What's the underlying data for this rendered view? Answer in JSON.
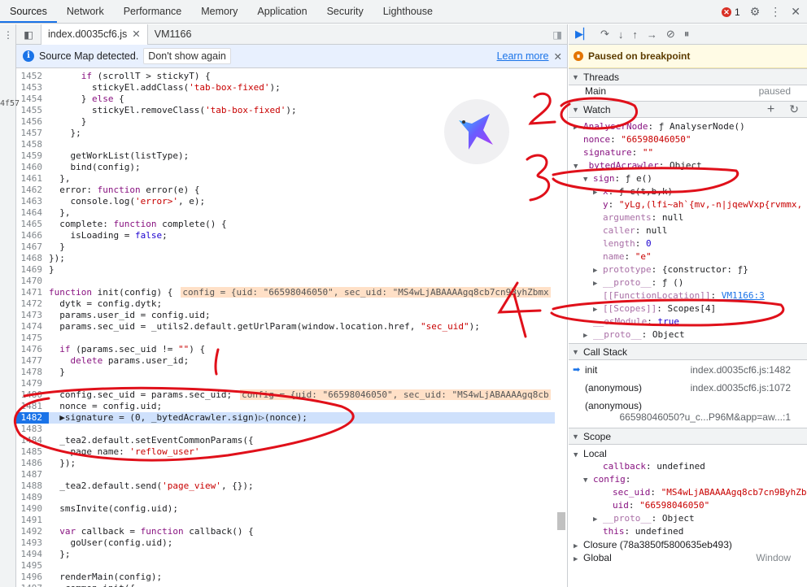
{
  "devtools_tabs": [
    "Sources",
    "Network",
    "Performance",
    "Memory",
    "Application",
    "Security",
    "Lighthouse"
  ],
  "active_tab": "Sources",
  "error_count": "1",
  "left_strip_label": "4f57",
  "file_tabs": [
    "index.d0035cf6.js",
    "VM1166"
  ],
  "source_map": {
    "message": "Source Map detected.",
    "dont_show": "Don't show again",
    "learn_more": "Learn more"
  },
  "paused_banner": "Paused on breakpoint",
  "code_lines": [
    {
      "n": "1452",
      "t": "      if (scrollT > stickyT) {"
    },
    {
      "n": "1453",
      "t": "        stickyEl.addClass('tab-box-fixed');"
    },
    {
      "n": "1454",
      "t": "      } else {"
    },
    {
      "n": "1455",
      "t": "        stickyEl.removeClass('tab-box-fixed');"
    },
    {
      "n": "1456",
      "t": "      }"
    },
    {
      "n": "1457",
      "t": "    };"
    },
    {
      "n": "1458",
      "t": ""
    },
    {
      "n": "1459",
      "t": "    getWorkList(listType);"
    },
    {
      "n": "1460",
      "t": "    bind(config);"
    },
    {
      "n": "1461",
      "t": "  },"
    },
    {
      "n": "1462",
      "t": "  error: function error(e) {"
    },
    {
      "n": "1463",
      "t": "    console.log('error>', e);"
    },
    {
      "n": "1464",
      "t": "  },"
    },
    {
      "n": "1465",
      "t": "  complete: function complete() {"
    },
    {
      "n": "1466",
      "t": "    isLoading = false;"
    },
    {
      "n": "1467",
      "t": "  }"
    },
    {
      "n": "1468",
      "t": "});"
    },
    {
      "n": "1469",
      "t": "}"
    },
    {
      "n": "1470",
      "t": ""
    },
    {
      "n": "1471",
      "t": "function init(config) {",
      "v": "config = {uid: \"66598046050\", sec_uid: \"MS4wLjABAAAAgq8cb7cn9ByhZbmx"
    },
    {
      "n": "1472",
      "t": "  dytk = config.dytk;"
    },
    {
      "n": "1473",
      "t": "  params.user_id = config.uid;"
    },
    {
      "n": "1474",
      "t": "  params.sec_uid = _utils2.default.getUrlParam(window.location.href, \"sec_uid\");"
    },
    {
      "n": "1475",
      "t": ""
    },
    {
      "n": "1476",
      "t": "  if (params.sec_uid != \"\") {"
    },
    {
      "n": "1477",
      "t": "    delete params.user_id;"
    },
    {
      "n": "1478",
      "t": "  }"
    },
    {
      "n": "1479",
      "t": ""
    },
    {
      "n": "1480",
      "t": "  config.sec_uid = params.sec_uid;",
      "v": "config = {uid: \"66598046050\", sec_uid: \"MS4wLjABAAAAgq8cb"
    },
    {
      "n": "1481",
      "t": "  nonce = config.uid;"
    },
    {
      "n": "1482",
      "t": "  ▶signature = (0, _bytedAcrawler.sign)▷(nonce);",
      "hl": true
    },
    {
      "n": "1483",
      "t": ""
    },
    {
      "n": "1484",
      "t": "  _tea2.default.setEventCommonParams({"
    },
    {
      "n": "1485",
      "t": "    page_name: 'reflow_user'"
    },
    {
      "n": "1486",
      "t": "  });"
    },
    {
      "n": "1487",
      "t": ""
    },
    {
      "n": "1488",
      "t": "  _tea2.default.send('page_view', {});"
    },
    {
      "n": "1489",
      "t": ""
    },
    {
      "n": "1490",
      "t": "  smsInvite(config.uid);"
    },
    {
      "n": "1491",
      "t": ""
    },
    {
      "n": "1492",
      "t": "  var callback = function callback() {"
    },
    {
      "n": "1493",
      "t": "    goUser(config.uid);"
    },
    {
      "n": "1494",
      "t": "  };"
    },
    {
      "n": "1495",
      "t": ""
    },
    {
      "n": "1496",
      "t": "  renderMain(config);"
    },
    {
      "n": "1497",
      "t": "  _common.init({"
    }
  ],
  "threads": {
    "title": "Threads",
    "main": "Main",
    "status": "paused"
  },
  "watch": {
    "title": "Watch",
    "rows": [
      {
        "i": 0,
        "tri": "▶",
        "k": "AnalyserNode",
        "v": "ƒ AnalyserNode()"
      },
      {
        "i": 0,
        "tri": "",
        "k": "nonce",
        "v": "\"66598046050\"",
        "c": "pstr"
      },
      {
        "i": 0,
        "tri": "",
        "k": "signature",
        "v": "\"\"",
        "c": "pstr"
      },
      {
        "i": 0,
        "tri": "▼",
        "k": "_bytedAcrawler",
        "v": "Object"
      },
      {
        "i": 1,
        "tri": "▼",
        "k": "sign",
        "v": "ƒ e()"
      },
      {
        "i": 2,
        "tri": "▶",
        "k": "x",
        "v": "ƒ c(t,b,k)"
      },
      {
        "i": 2,
        "tri": "",
        "k": "y",
        "v": "\"yLg,(lfi~ah`{mv,-n|jqewVxp{rvmmx,",
        "c": "pstr"
      },
      {
        "i": 2,
        "tri": "",
        "k": "arguments",
        "v": "null",
        "d": true
      },
      {
        "i": 2,
        "tri": "",
        "k": "caller",
        "v": "null",
        "d": true
      },
      {
        "i": 2,
        "tri": "",
        "k": "length",
        "v": "0",
        "c": "pnum",
        "d": true
      },
      {
        "i": 2,
        "tri": "",
        "k": "name",
        "v": "\"e\"",
        "c": "pstr",
        "d": true
      },
      {
        "i": 2,
        "tri": "▶",
        "k": "prototype",
        "v": "{constructor: ƒ}",
        "d": true
      },
      {
        "i": 2,
        "tri": "▶",
        "k": "__proto__",
        "v": "ƒ ()",
        "d": true
      },
      {
        "i": 2,
        "tri": "",
        "k": "[[FunctionLocation]]",
        "v": "VM1166:3",
        "c": "plink",
        "d": true
      },
      {
        "i": 2,
        "tri": "▶",
        "k": "[[Scopes]]",
        "v": "Scopes[4]",
        "d": true
      },
      {
        "i": 1,
        "tri": "",
        "k": "__esModule",
        "v": "true",
        "c": "pnum",
        "d": true
      },
      {
        "i": 1,
        "tri": "▶",
        "k": "__proto__",
        "v": "Object",
        "d": true
      }
    ]
  },
  "call_stack": {
    "title": "Call Stack",
    "frames": [
      {
        "fn": "init",
        "loc": "index.d0035cf6.js:1482",
        "cur": true
      },
      {
        "fn": "(anonymous)",
        "loc": "index.d0035cf6.js:1072"
      },
      {
        "fn": "(anonymous)",
        "loc": "66598046050?u_c...P96M&app=aw...:1"
      }
    ]
  },
  "scope": {
    "title": "Scope",
    "rows": [
      {
        "i": 0,
        "tri": "▼",
        "k": "Local",
        "v": "",
        "plain": true
      },
      {
        "i": 2,
        "tri": "",
        "k": "callback",
        "v": "undefined"
      },
      {
        "i": 1,
        "tri": "▼",
        "k": "config",
        "v": ""
      },
      {
        "i": 3,
        "tri": "",
        "k": "sec_uid",
        "v": "\"MS4wLjABAAAAgq8cb7cn9ByhZbm",
        "c": "pstr"
      },
      {
        "i": 3,
        "tri": "",
        "k": "uid",
        "v": "\"66598046050\"",
        "c": "pstr"
      },
      {
        "i": 2,
        "tri": "▶",
        "k": "__proto__",
        "v": "Object",
        "d": true
      },
      {
        "i": 2,
        "tri": "",
        "k": "this",
        "v": "undefined"
      },
      {
        "i": 0,
        "tri": "▶",
        "k": "Closure (78a3850f5800635eb493)",
        "v": "",
        "plain": true
      },
      {
        "i": 0,
        "tri": "▶",
        "k": "Global",
        "v": "",
        "plain": true,
        "side": "Window"
      }
    ]
  },
  "annotations": [
    "1",
    "2",
    "3",
    "4"
  ]
}
